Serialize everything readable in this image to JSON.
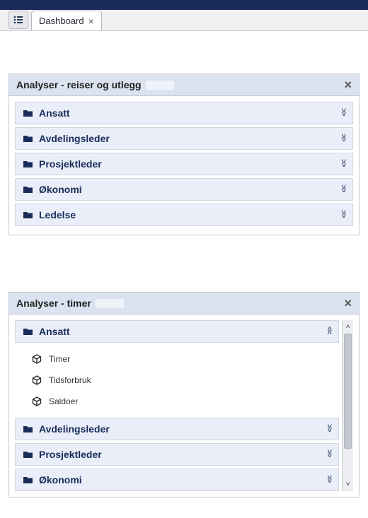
{
  "tabstrip": {
    "tab1_label": "Dashboard"
  },
  "panels": {
    "p1": {
      "title": "Analyser - reiser og utlegg",
      "groups": {
        "g0": "Ansatt",
        "g1": "Avdelingsleder",
        "g2": "Prosjektleder",
        "g3": "Økonomi",
        "g4": "Ledelse"
      }
    },
    "p2": {
      "title": "Analyser - timer",
      "groups": {
        "g0": "Ansatt",
        "g1": "Avdelingsleder",
        "g2": "Prosjektleder",
        "g3": "Økonomi"
      },
      "g0_items": {
        "i0": "Timer",
        "i1": "Tidsforbruk",
        "i2": "Saldoer"
      }
    }
  }
}
